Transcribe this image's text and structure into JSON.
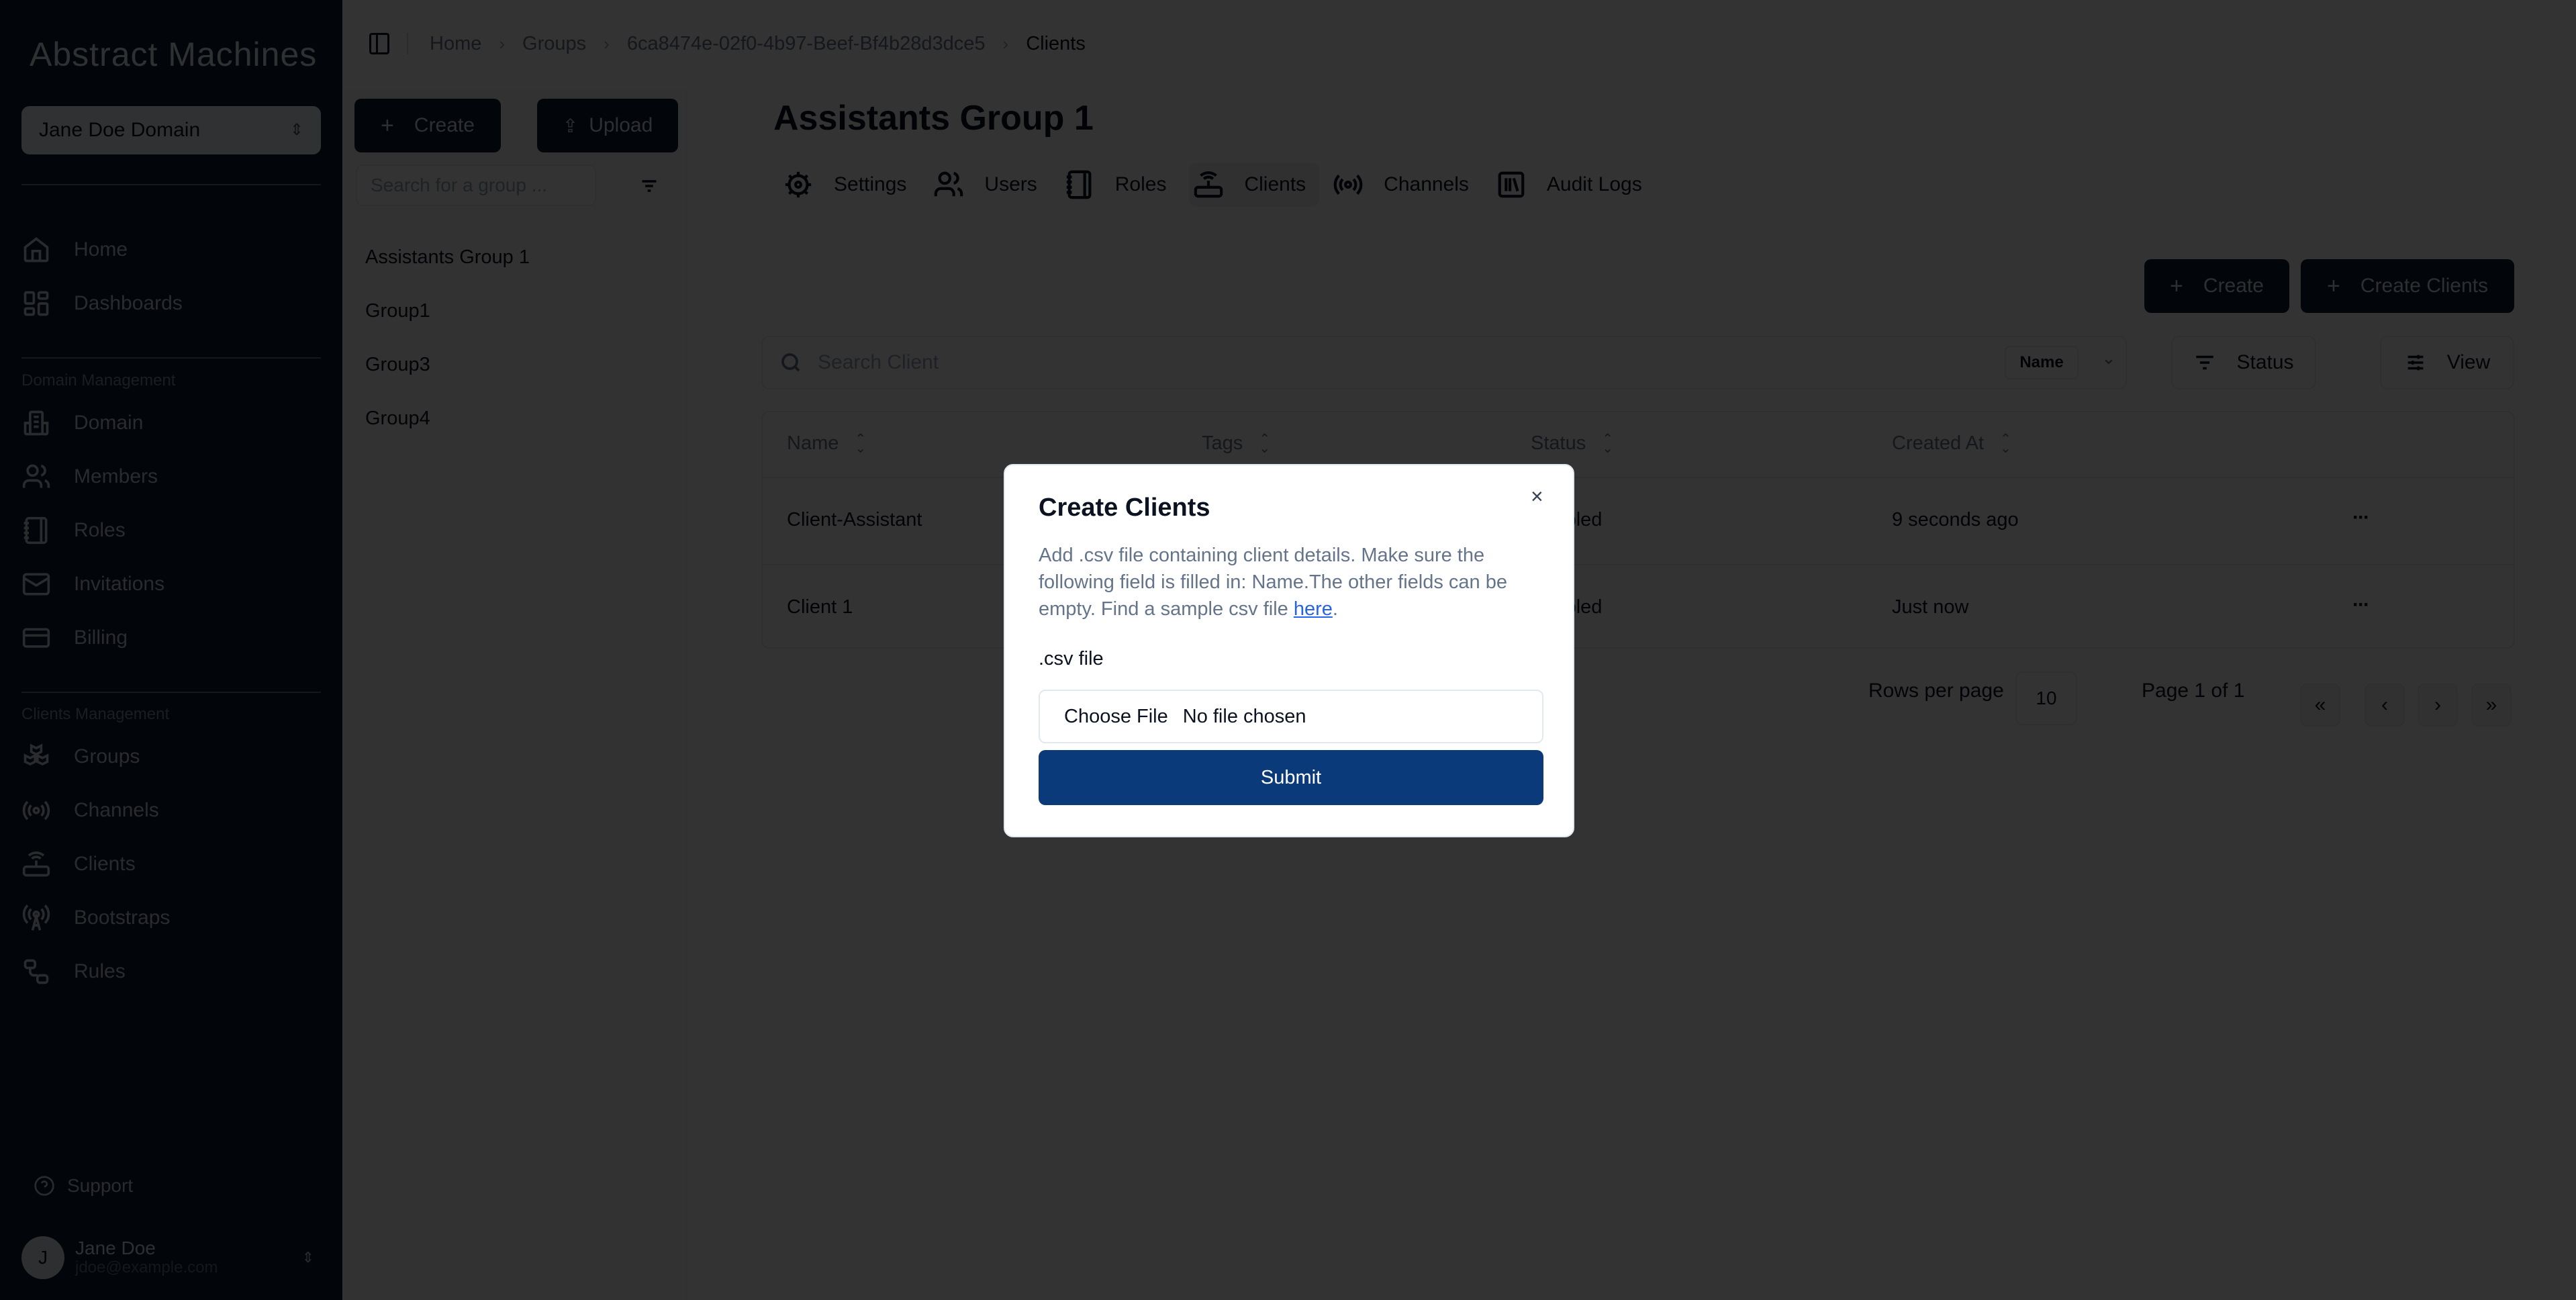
{
  "app": {
    "brand": "Abstract Machines",
    "domain_selector": "Jane Doe Domain"
  },
  "sidebar": {
    "top_items": [
      {
        "label": "Home",
        "icon": "home-icon"
      },
      {
        "label": "Dashboards",
        "icon": "dashboard-icon"
      }
    ],
    "sections": [
      {
        "title": "Domain Management",
        "items": [
          {
            "label": "Domain",
            "icon": "building-icon"
          },
          {
            "label": "Members",
            "icon": "users-icon"
          },
          {
            "label": "Roles",
            "icon": "notebook-icon"
          },
          {
            "label": "Invitations",
            "icon": "mail-icon"
          },
          {
            "label": "Billing",
            "icon": "credit-card-icon"
          }
        ]
      },
      {
        "title": "Clients Management",
        "items": [
          {
            "label": "Groups",
            "icon": "boxes-icon"
          },
          {
            "label": "Channels",
            "icon": "radio-icon"
          },
          {
            "label": "Clients",
            "icon": "router-icon"
          },
          {
            "label": "Bootstraps",
            "icon": "antenna-icon"
          },
          {
            "label": "Rules",
            "icon": "workflow-icon"
          }
        ]
      }
    ],
    "support_label": "Support",
    "user": {
      "initial": "J",
      "name": "Jane Doe",
      "email": "jdoe@example.com"
    }
  },
  "breadcrumb": {
    "items": [
      "Home",
      "Groups",
      "6ca8474e-02f0-4b97-Beef-Bf4b28d3dce5"
    ],
    "current": "Clients"
  },
  "groups_panel": {
    "create_label": "Create",
    "upload_label": "Upload",
    "search_placeholder": "Search for a group ...",
    "groups": [
      "Assistants Group 1",
      "Group1",
      "Group3",
      "Group4"
    ]
  },
  "main": {
    "title": "Assistants Group 1",
    "tabs": [
      {
        "label": "Settings",
        "icon": "gear-icon",
        "active": false
      },
      {
        "label": "Users",
        "icon": "users-icon",
        "active": false
      },
      {
        "label": "Roles",
        "icon": "notebook-icon",
        "active": false
      },
      {
        "label": "Clients",
        "icon": "router-icon",
        "active": true
      },
      {
        "label": "Channels",
        "icon": "radio-icon",
        "active": false
      },
      {
        "label": "Audit Logs",
        "icon": "library-icon",
        "active": false
      }
    ],
    "create_label": "Create",
    "create_clients_label": "Create Clients",
    "search_placeholder": "Search Client",
    "search_field_select": "Name",
    "status_filter_label": "Status",
    "view_label": "View",
    "table": {
      "columns": [
        "Name",
        "Tags",
        "Status",
        "Created At"
      ],
      "rows": [
        {
          "name": "Client-Assistant",
          "tags": "",
          "status": "Enabled",
          "created_at": "9 seconds ago"
        },
        {
          "name": "Client 1",
          "tags": "",
          "status": "Enabled",
          "created_at": "Just now"
        }
      ]
    },
    "pagination": {
      "rows_per_page_label": "Rows per page",
      "rows_per_page": "10",
      "page_info": "Page 1 of 1",
      "first": "«",
      "prev": "‹",
      "next": "›",
      "last": "»"
    }
  },
  "modal": {
    "title": "Create Clients",
    "description": "Add .csv file containing client details. Make sure the following field is filled in: Name.The other fields can be empty. Find a sample csv file ",
    "link_text": "here",
    "description_end": ".",
    "file_label": ".csv file",
    "choose_file": "Choose File",
    "no_file": "No file chosen",
    "submit_label": "Submit",
    "close": "×"
  },
  "colors": {
    "sidebar_bg": "#0b1a33",
    "primary_button": "#0b1a33",
    "submit_button": "#0b3a7a",
    "link": "#2563eb"
  }
}
